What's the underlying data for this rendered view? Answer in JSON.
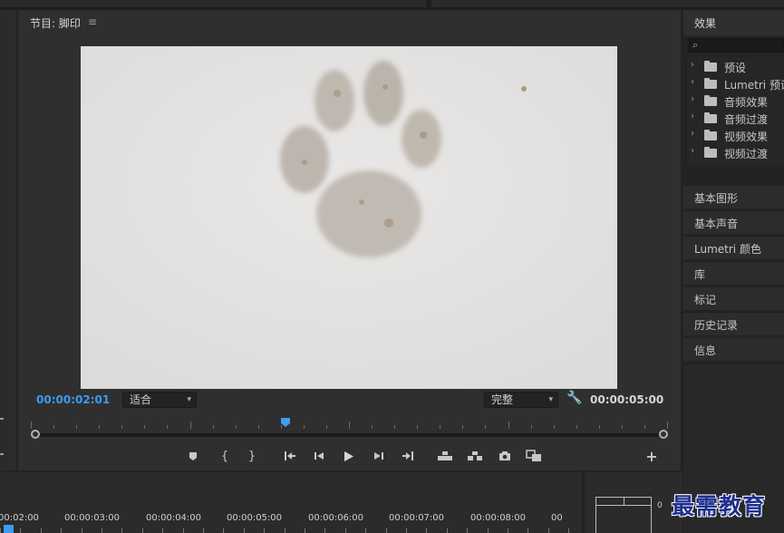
{
  "program_monitor": {
    "title": "节目: 脚印",
    "menu_icon": "≡",
    "current_timecode": "00:00:02:01",
    "fit_select": {
      "value": "适合"
    },
    "quality_select": {
      "value": "完整"
    },
    "duration_timecode": "00:00:05:00",
    "playhead_fraction": 0.4
  },
  "transport": {
    "add_marker": "marker-icon",
    "mark_in": "mark-in-icon",
    "mark_out": "mark-out-icon",
    "go_to_in": "go-to-in-icon",
    "step_back": "step-back-icon",
    "play": "play-icon",
    "step_forward": "step-forward-icon",
    "go_to_out": "go-to-out-icon",
    "lift": "lift-icon",
    "extract": "extract-icon",
    "export_frame": "camera-icon",
    "compare": "compare-icon",
    "button_editor": "+"
  },
  "effects_panel": {
    "title": "效果",
    "search_placeholder": "",
    "items": [
      {
        "label": "预设",
        "icon": "folder-icon-star"
      },
      {
        "label": "Lumetri 预设",
        "icon": "folder-icon-star"
      },
      {
        "label": "音频效果",
        "icon": "folder-icon"
      },
      {
        "label": "音频过渡",
        "icon": "folder-icon"
      },
      {
        "label": "视频效果",
        "icon": "folder-icon"
      },
      {
        "label": "视频过渡",
        "icon": "folder-icon"
      }
    ]
  },
  "panel_tabs": [
    {
      "label": "基本图形"
    },
    {
      "label": "基本声音"
    },
    {
      "label": "Lumetri 颜色"
    },
    {
      "label": "库"
    },
    {
      "label": "标记"
    },
    {
      "label": "历史记录"
    },
    {
      "label": "信息"
    }
  ],
  "timeline": {
    "labels": [
      "00:02:00",
      "00:00:03:00",
      "00:00:04:00",
      "00:00:05:00",
      "00:00:06:00",
      "00:00:07:00",
      "00:00:08:00",
      "00"
    ]
  },
  "audio_meter": {
    "zero_label": "0"
  },
  "watermark": "最需教育",
  "colors": {
    "accent": "#3c9cef",
    "panel_bg": "#2f2f2f",
    "app_bg": "#232323"
  }
}
